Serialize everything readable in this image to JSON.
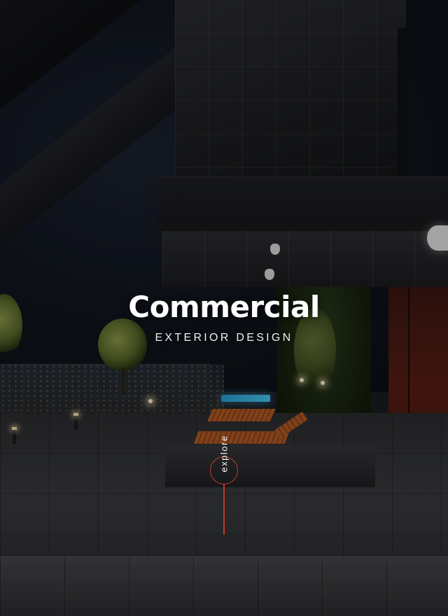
{
  "hero": {
    "title": "Commercial",
    "subtitle": "EXTERIOR DESIGN",
    "explore_label": "explore",
    "accent_color": "#c0392b"
  }
}
